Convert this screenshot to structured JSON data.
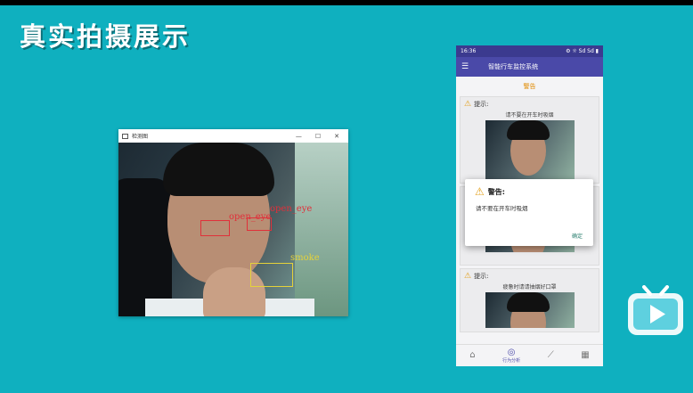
{
  "slide": {
    "title": "真实拍摄展示"
  },
  "window": {
    "title": "检测图",
    "controls": {
      "minimize": "—",
      "maximize": "☐",
      "close": "✕"
    },
    "detections": [
      {
        "label": "open_eye"
      },
      {
        "label": "open_eye"
      },
      {
        "label": "smoke"
      }
    ]
  },
  "phone": {
    "status_time": "16:36",
    "status_right": "⚙ ☼ Sd Sd ▮",
    "app_title": "智能行车监控系统",
    "sub_tab": "警告",
    "cards": [
      {
        "header": "提示:",
        "text": "请不要在开车时吸烟"
      },
      {
        "header": "",
        "text": ""
      },
      {
        "header": "提示:",
        "text": "疲惫时请请抽烟好口罩"
      }
    ],
    "dialog": {
      "title": "警告:",
      "message": "请不要在开车时吸烟",
      "confirm": "确定"
    },
    "nav": [
      {
        "icon": "home-icon",
        "glyph": "⌂",
        "label": ""
      },
      {
        "icon": "behavior-analysis-icon",
        "glyph": "◎",
        "label": "行为分析"
      },
      {
        "icon": "trend-chart-icon",
        "glyph": "⟋",
        "label": ""
      },
      {
        "icon": "grid-icon",
        "glyph": "▦",
        "label": ""
      }
    ]
  },
  "colors": {
    "background": "#0fb0bf",
    "appbar": "#4a49a8",
    "warning": "#e3a01b",
    "detect_red": "#e0303a",
    "detect_yellow": "#e5d23a"
  }
}
